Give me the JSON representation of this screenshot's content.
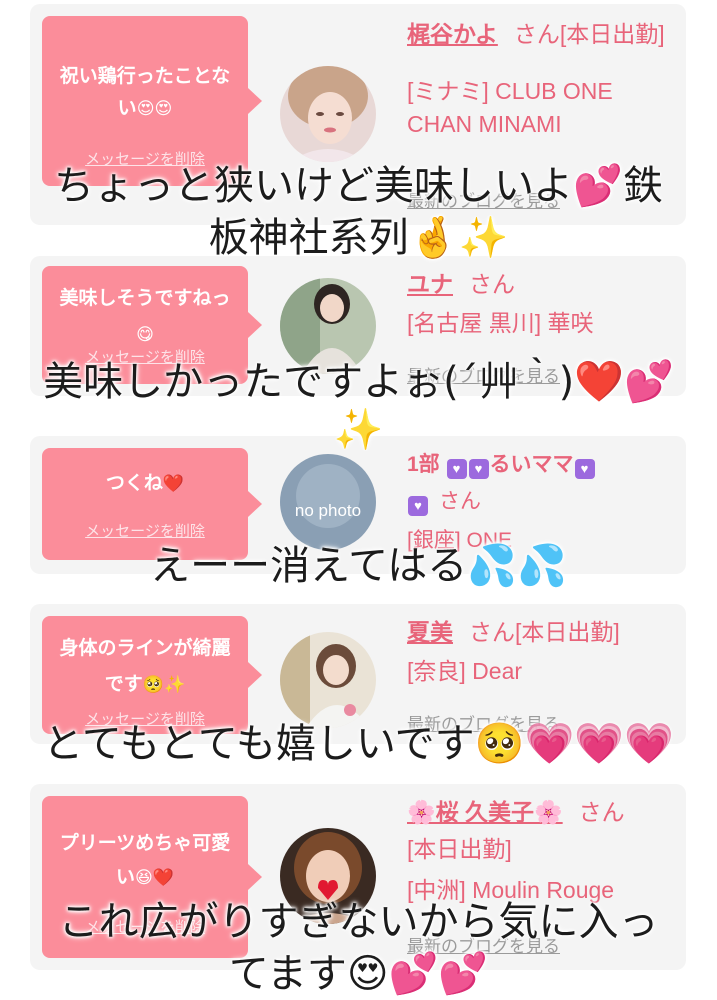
{
  "comments": [
    {
      "bubble_text": "祝い鶏行ったことない",
      "bubble_emoji": "😍😍",
      "delete_label": "メッセージを削除",
      "name": "梶谷かよ",
      "suffix": "さん[本日出勤]",
      "store_lines": [
        "[ミナミ] CLUB ONE",
        "CHAN MINAMI"
      ],
      "blog_label": "最新のブログを見る",
      "reply_lines": [
        "ちょっと狭いけど美味しいよ💕鉄",
        "板神社系列🤞✨"
      ]
    },
    {
      "bubble_text": "美味しそうですねっ",
      "bubble_emoji": "😋",
      "delete_label": "メッセージを削除",
      "name": "ユナ",
      "suffix": "さん",
      "store_lines": [
        "[名古屋 黒川] 華咲"
      ],
      "blog_label": "最新のブログを見る",
      "reply_lines": [
        "美味しかったですよぉ(´艸｀)❤️💕",
        "✨"
      ]
    },
    {
      "bubble_text": "つくね",
      "bubble_emoji": "❤️",
      "delete_label": "メッセージを削除",
      "name_prefix": "1部",
      "name_box": "💟💟",
      "name": "るいママ",
      "name_box_end": "💟",
      "name_box_line2": "💟",
      "suffix": "さん",
      "store_lines": [
        "[銀座] ONE"
      ],
      "avatar_text": "no photo",
      "reply_lines": [
        "えーー消えてはる💦💦"
      ]
    },
    {
      "bubble_text": "身体のラインが綺麗です",
      "bubble_emoji": "🥺✨",
      "delete_label": "メッセージを削除",
      "name": "夏美",
      "suffix": "さん[本日出勤]",
      "store_lines": [
        "[奈良] Dear"
      ],
      "blog_label": "最新のブログを見る",
      "reply_lines": [
        "とてもとても嬉しいです🥺💗💗💗"
      ]
    },
    {
      "bubble_text": "プリーツめちゃ可愛い",
      "bubble_emoji": "😆❤️",
      "delete_label": "メッセージを削除",
      "name": "🌸桜 久美子🌸",
      "suffix": "さん",
      "store_lines": [
        "[本日出勤]",
        "[中洲] Moulin Rouge"
      ],
      "blog_label": "最新のブログを見る",
      "reply_lines": [
        "これ広がりすぎないから気に入っ",
        "てます😍💕💕"
      ]
    }
  ],
  "colors": {
    "bubble": "#fb8d9a",
    "card": "#f4f4f4",
    "name": "#e8647a",
    "heart": "#e11931"
  }
}
